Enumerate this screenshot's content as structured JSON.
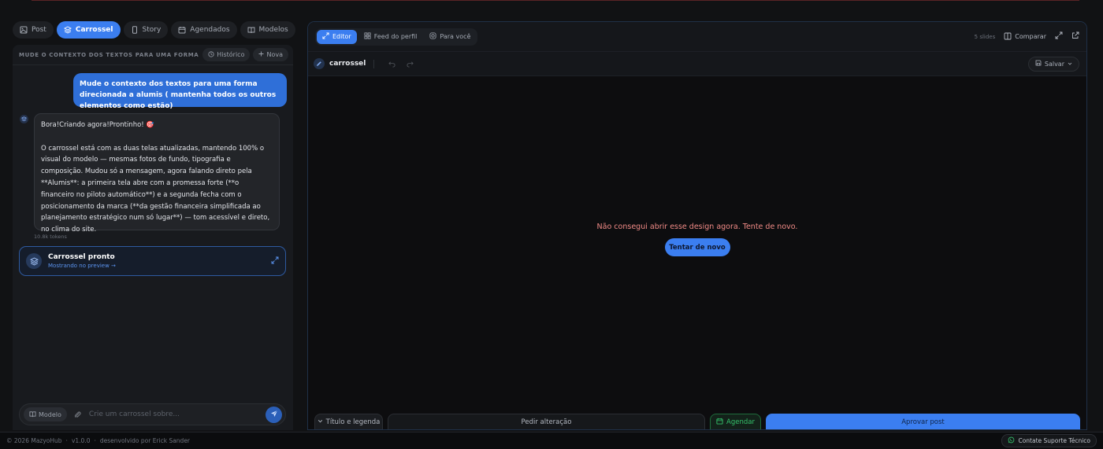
{
  "mode_tabs": [
    {
      "label": "Post",
      "icon": "image-icon"
    },
    {
      "label": "Carrossel",
      "icon": "layers-icon",
      "active": true
    },
    {
      "label": "Story",
      "icon": "phone-icon"
    },
    {
      "label": "Agendados",
      "icon": "calendar-icon"
    },
    {
      "label": "Modelos",
      "icon": "book-icon"
    }
  ],
  "chat": {
    "context_title": "MUDE O CONTEXTO DOS TEXTOS PARA UMA FORMA",
    "history_label": "Histórico",
    "new_label": "Nova",
    "user_message": "Mude o contexto dos textos para uma forma direcionada a alumis ( mantenha todos os outros elementos como estão)",
    "bot_message": "Bora!Criando agora!Prontinho! 🎯\n\nO carrossel está com as duas telas atualizadas, mantendo 100% o visual do modelo — mesmas fotos de fundo, tipografia e composição. Mudou só a mensagem, agora falando direto pela **Alumis**: a primeira tela abre com a promessa forte (**o financeiro no piloto automático**) e a segunda fecha com o posicionamento da marca (**da gestão financeira simplificada ao planejamento estratégico num só lugar**) — tom acessível e direto, no clima do site.",
    "tokens": "10.8k tokens",
    "ready_card": {
      "title": "Carrossel pronto",
      "subtitle": "Mostrando no preview →"
    },
    "composer": {
      "model_label": "Modelo",
      "placeholder": "Crie um carrossel sobre..."
    }
  },
  "preview": {
    "view_tabs": [
      {
        "label": "Editor",
        "icon": "expand-icon",
        "active": true
      },
      {
        "label": "Feed do perfil",
        "icon": "grid-icon"
      },
      {
        "label": "Para você",
        "icon": "instagram-icon"
      }
    ],
    "slides_count": "5 slides",
    "compare_label": "Comparar",
    "document_name": "carrossel",
    "save_label": "Salvar",
    "error_message": "Não consegui abrir esse design agora. Tente de novo.",
    "retry_label": "Tentar de novo",
    "bottom": {
      "legend_label": "Título e legenda",
      "change_label": "Pedir alteração",
      "schedule_label": "Agendar",
      "approve_label": "Aprovar post"
    }
  },
  "footer": {
    "copyright": "© 2026 MazyoHub",
    "version": "v1.0.0",
    "credit": "desenvolvido por Erick Sander",
    "support_label": "Contate Suporte Técnico"
  },
  "colors": {
    "accent": "#3b7ef0",
    "error": "#f08a86",
    "success": "#35c16b"
  }
}
